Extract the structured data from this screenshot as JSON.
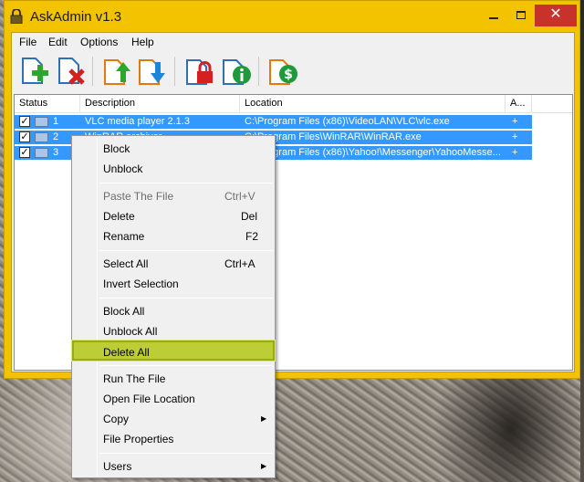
{
  "window": {
    "title": "AskAdmin v1.3"
  },
  "menubar": [
    "File",
    "Edit",
    "Options",
    "Help"
  ],
  "toolbar": [
    {
      "icon": "add-file-icon"
    },
    {
      "icon": "remove-file-icon"
    },
    {
      "icon": "import-icon"
    },
    {
      "icon": "export-icon"
    },
    {
      "icon": "lock-icon"
    },
    {
      "icon": "info-icon"
    },
    {
      "icon": "donate-icon"
    }
  ],
  "list": {
    "columns": [
      "Status",
      "Description",
      "Location",
      "A..."
    ],
    "rows": [
      {
        "num": "1",
        "description": "VLC media player 2.1.3",
        "location": "C:\\Program Files (x86)\\VideoLAN\\VLC\\vlc.exe",
        "a": "+"
      },
      {
        "num": "2",
        "description": "WinRAR archiver",
        "location": "C:\\Program Files\\WinRAR\\WinRAR.exe",
        "a": "+"
      },
      {
        "num": "3",
        "description": "",
        "location": "C:\\Program Files (x86)\\Yahoo!\\Messenger\\YahooMesse...",
        "a": "+"
      }
    ]
  },
  "context_menu": {
    "items": [
      {
        "label": "Block",
        "key": ""
      },
      {
        "label": "Unblock",
        "key": ""
      },
      {
        "label": "Paste The File",
        "key": "Ctrl+V"
      },
      {
        "label": "Delete",
        "key": "Del"
      },
      {
        "label": "Rename",
        "key": "F2"
      },
      {
        "label": "Select All",
        "key": "Ctrl+A"
      },
      {
        "label": "Invert Selection",
        "key": ""
      },
      {
        "label": "Block All",
        "key": ""
      },
      {
        "label": "Unblock All",
        "key": ""
      },
      {
        "label": "Delete All",
        "key": ""
      },
      {
        "label": "Run The File",
        "key": ""
      },
      {
        "label": "Open File Location",
        "key": ""
      },
      {
        "label": "Copy",
        "key": ""
      },
      {
        "label": "File Properties",
        "key": ""
      },
      {
        "label": "Users",
        "key": ""
      }
    ],
    "highlight_color": "#bccd36"
  },
  "colors": {
    "titlebar": "#f3c300",
    "selection": "#3399ff",
    "close": "#c7322b"
  }
}
